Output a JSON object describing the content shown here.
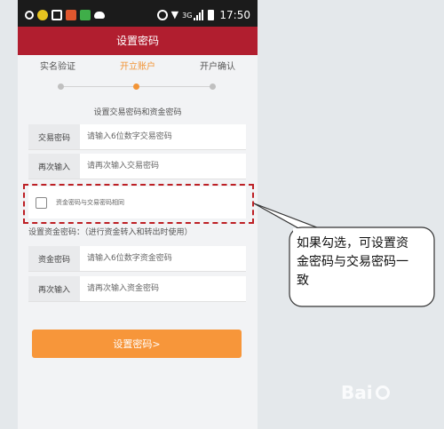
{
  "status_bar": {
    "network": "3G",
    "time": "17:50",
    "icons": [
      "search-icon",
      "app-icon",
      "gallery-icon",
      "app-icon",
      "app-icon",
      "weather-icon",
      "alarm-icon",
      "wifi-icon",
      "signal-icon",
      "battery-icon"
    ]
  },
  "header": {
    "title": "设置密码"
  },
  "steps": [
    {
      "label": "实名验证",
      "active": false
    },
    {
      "label": "开立账户",
      "active": true
    },
    {
      "label": "开户确认",
      "active": false
    }
  ],
  "form": {
    "section_title": "设置交易密码和资金密码",
    "trade_password": {
      "label": "交易密码",
      "placeholder": "请输入6位数字交易密码"
    },
    "trade_confirm": {
      "label": "再次输入",
      "placeholder": "请再次输入交易密码"
    },
    "same_checkbox_label": "资金密码与交易密码相同",
    "fund_note": "设置资金密码：（进行资金转入和转出时使用）",
    "fund_password": {
      "label": "资金密码",
      "placeholder": "请输入6位数字资金密码"
    },
    "fund_confirm": {
      "label": "再次输入",
      "placeholder": "请再次输入资金密码"
    },
    "submit_label": "设置密码>"
  },
  "annotation": {
    "callout_text": "如果勾选，可设置资金密码与交易密码一致"
  },
  "watermark": {
    "text": "Bai"
  },
  "colors": {
    "header": "#b11e2f",
    "accent": "#f29436",
    "button": "#f7963a",
    "highlight": "#bd2025"
  }
}
